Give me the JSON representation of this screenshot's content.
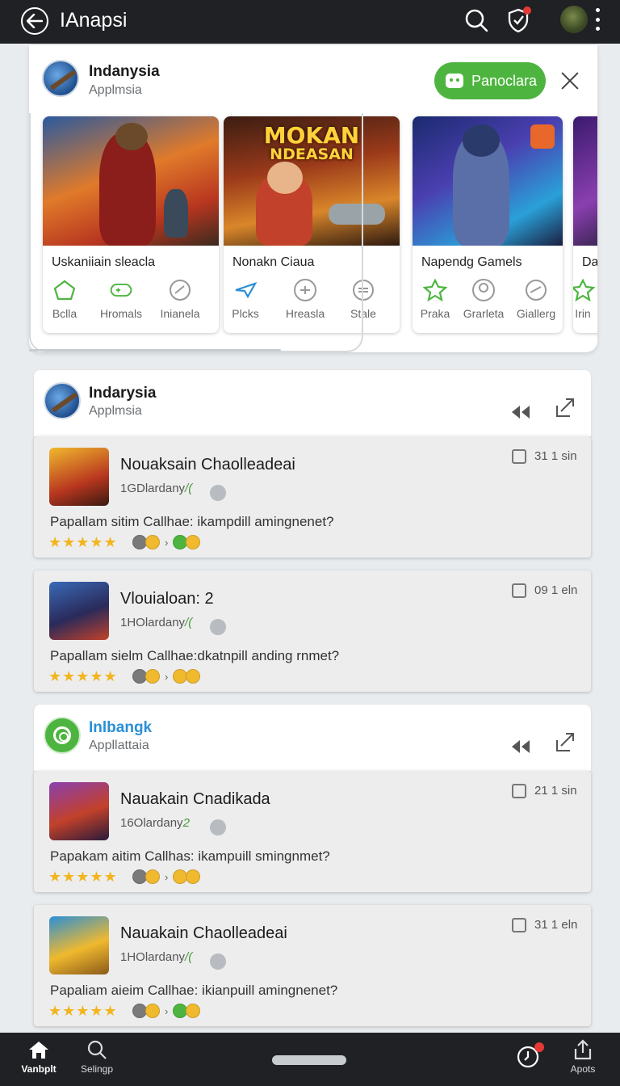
{
  "topbar": {
    "title": "IAnapsi",
    "icons": [
      "back-arrow-icon",
      "search-icon",
      "shield-check-icon",
      "avatar",
      "more-vert-icon"
    ]
  },
  "featured": {
    "app_name": "Indanysia",
    "app_sub": "Applmsia",
    "install_label": "Panoclara",
    "games": [
      {
        "name": "Uskaniiain sleacla",
        "actions": [
          "Bclla",
          "Hromals",
          "Inianela"
        ]
      },
      {
        "name": "Nonakn Ciaua",
        "banner_line1": "MOKAN",
        "banner_line2": "NDEASAN",
        "actions": [
          "Plcks",
          "Hreasla",
          "Stale"
        ]
      },
      {
        "name": "Napendg Gamels",
        "actions": [
          "Praka",
          "Grarleta",
          "Giallerg"
        ]
      },
      {
        "name": "Da",
        "actions": [
          "Irin"
        ]
      }
    ]
  },
  "sections": [
    {
      "name": "Indarysia",
      "sub": "Applmsia",
      "reviews": [
        {
          "title": "Nouaksain Chaolleadeai",
          "meta": "1GDlardany",
          "meta_suffix": "/(",
          "time": "31 1 sin",
          "text": "Papallam sitim Callhae: ikampdill amingnenet?",
          "stars": "★★★★★"
        },
        {
          "title": "Vlouialoan: 2",
          "meta": "1HOlardany",
          "meta_suffix": "/(",
          "time": "09 1 eln",
          "text": "Papallam sielm Callhae:dkatnpill anding rnmet?",
          "stars": "★★★★★"
        }
      ]
    },
    {
      "name": "Inlbangk",
      "sub": "Appllattaia",
      "reviews": [
        {
          "title": "Nauakain Cnadikada",
          "meta": "16Olardany",
          "meta_suffix": "2",
          "time": "21 1 sin",
          "text": "Papakam aitim Callhas: ikampuill smingnmet?",
          "stars": "★★★★★"
        },
        {
          "title": "Nauakain Chaolleadeai",
          "meta": "1HOlardany",
          "meta_suffix": "/(",
          "time": "31 1 eln",
          "text": "Papaliam aieim Callhae: ikianpuill amingnenet?",
          "stars": "★★★★★"
        }
      ]
    }
  ],
  "bottomnav": {
    "items": [
      "Vanbplt",
      "Selingp",
      "Apots"
    ]
  },
  "colors": {
    "accent_green": "#4db53f",
    "bar_dark": "#1f2124",
    "star": "#f2b51d",
    "notify_red": "#e53935"
  }
}
